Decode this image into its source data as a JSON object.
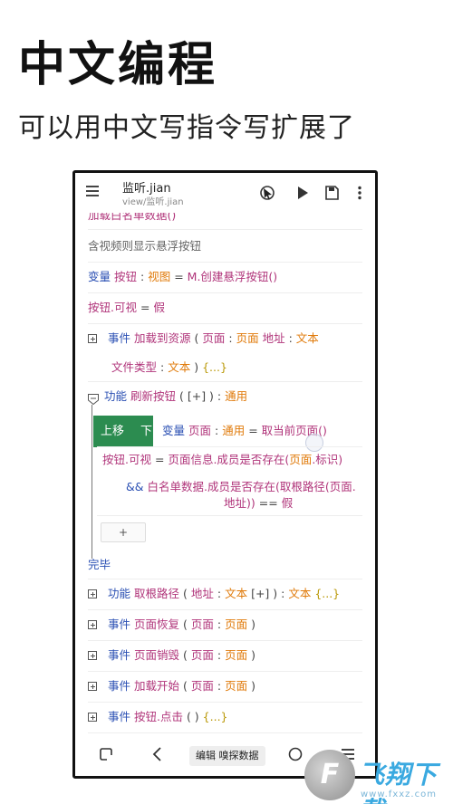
{
  "hero": {
    "title": "中文编程",
    "subtitle": "可以用中文写指令写扩展了"
  },
  "appbar": {
    "title": "监听.jian",
    "path": "view/监听.jian",
    "icons": [
      "menu-icon",
      "cursor-toggle-icon",
      "play-icon",
      "save-icon",
      "more-vert-icon"
    ]
  },
  "code": {
    "l0_text": "加载白名单数据()",
    "l1_comment": "含视频则显示悬浮按钮",
    "l2": {
      "kw": "变量",
      "name": "按钮",
      "colon": ":",
      "type": "视图",
      "eq": "=",
      "expr": "M.创建悬浮按钮()"
    },
    "l3": {
      "expr": "按钮.可视",
      "eq": "=",
      "val": "假"
    },
    "l4": {
      "kw": "事件",
      "name": "加载到资源",
      "lp": "(",
      "p1": "页面",
      "c1": ":",
      "t1": "页面",
      "p2": "地址",
      "c2": ":",
      "t2": "文本"
    },
    "l5": {
      "p3": "文件类型",
      "c3": ":",
      "t3": "文本",
      "rp": ")",
      "fold": "{...}"
    },
    "l6": {
      "kw": "功能",
      "name": "刷新按钮",
      "params": "( [+] ) :",
      "type": "通用"
    },
    "l7": {
      "kw": "变量",
      "name": "页面",
      "colon": ":",
      "type": "通用",
      "eq": "=",
      "expr": "取当前页面()"
    },
    "l8": {
      "expr1": "按钮.可视",
      "eq": "=",
      "expr2": "页面信息.成员是否存在(",
      "arg": "页面",
      "expr3": ".标识)"
    },
    "l9": {
      "and": "&&",
      "expr": "白名单数据.成员是否存在(取根路径(页面."
    },
    "l10": {
      "expr": "地址))",
      "eq": "==",
      "val": "假"
    },
    "add_label": "+",
    "end": "完毕",
    "l12": {
      "kw": "功能",
      "name": "取根路径",
      "lp": "(",
      "p1": "地址",
      "c1": ":",
      "t1": "文本",
      "extra": "[+] ) :",
      "type": "文本",
      "fold": "{...}"
    },
    "l13": {
      "kw": "事件",
      "name": "页面恢复",
      "lp": "(",
      "p1": "页面",
      "c1": ":",
      "t1": "页面",
      "rp": ")"
    },
    "l14": {
      "kw": "事件",
      "name": "页面销毁",
      "lp": "(",
      "p1": "页面",
      "c1": ":",
      "t1": "页面",
      "rp": ")"
    },
    "l15": {
      "kw": "事件",
      "name": "加载开始",
      "lp": "(",
      "p1": "页面",
      "c1": ":",
      "t1": "页面",
      "rp": ")"
    },
    "l16": {
      "kw": "事件",
      "name": "按钮.点击",
      "params": "( )",
      "fold": "{...}"
    }
  },
  "move_buttons": {
    "up": "上移",
    "down": "下"
  },
  "navbar": {
    "chip": "编辑 嗅探数据",
    "icons": [
      "recent-apps-icon",
      "back-icon",
      "home-icon",
      "menu-icon"
    ]
  },
  "watermark": {
    "text": "飞翔下载",
    "url": "www.fxxz.com",
    "logo_letter": "F"
  },
  "colors": {
    "keyword": "#2a4fb3",
    "identifier": "#b0347a",
    "type": "#e07a0a",
    "fold": "#bb9a0b",
    "move_button": "#2c8c50"
  }
}
